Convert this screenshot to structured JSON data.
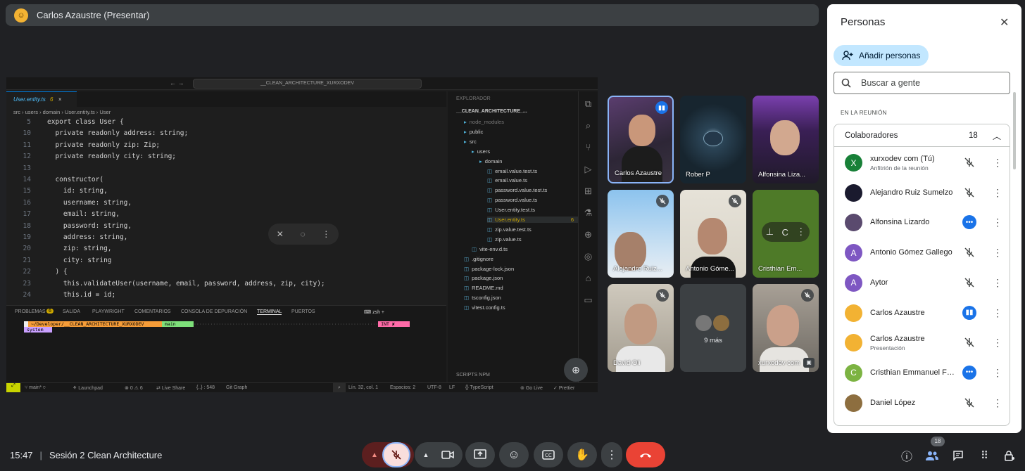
{
  "presenter_bar": {
    "title": "Carlos Azaustre (Presentar)"
  },
  "vscode": {
    "command_center": "__CLEAN_ARCHITECTURE_XURXODEV",
    "tab": {
      "name": "User.entity.ts",
      "problems": "6"
    },
    "breadcrumb": "src › users › domain › User.entity.ts › User",
    "code_lines": [
      {
        "n": "5",
        "text": "export class User {"
      },
      {
        "n": "10",
        "text": "  private readonly address: string;"
      },
      {
        "n": "11",
        "text": "  private readonly zip: Zip;"
      },
      {
        "n": "12",
        "text": "  private readonly city: string;"
      },
      {
        "n": "13",
        "text": ""
      },
      {
        "n": "14",
        "text": "  constructor("
      },
      {
        "n": "15",
        "text": "    id: string,"
      },
      {
        "n": "16",
        "text": "    username: string,"
      },
      {
        "n": "17",
        "text": "    email: string,"
      },
      {
        "n": "18",
        "text": "    password: string,"
      },
      {
        "n": "19",
        "text": "    address: string,"
      },
      {
        "n": "20",
        "text": "    zip: string,"
      },
      {
        "n": "21",
        "text": "    city: string"
      },
      {
        "n": "22",
        "text": "  ) {"
      },
      {
        "n": "23",
        "text": "    this.validateUser(username, email, password, address, zip, city);"
      },
      {
        "n": "24",
        "text": "    this.id = id;"
      }
    ],
    "panel_tabs": [
      "PROBLEMAS",
      "SALIDA",
      "PLAYWRIGHT",
      "COMENTARIOS",
      "CONSOLA DE DEPURACIÓN",
      "TERMINAL",
      "PUERTOS"
    ],
    "problems_count": "6",
    "terminal_shell": "zsh",
    "terminal_path": "~/Developer/__CLEAN_ARCHITECTURE_XURXODEV",
    "terminal_branch": "main",
    "terminal_int": "INT ✘",
    "terminal_system": "system",
    "explorer_title": "EXPLORADOR",
    "explorer_root": "__CLEAN_ARCHITECTURE_...",
    "explorer_items": [
      {
        "label": "node_modules",
        "depth": 1,
        "type": "folder"
      },
      {
        "label": "public",
        "depth": 1,
        "type": "folder"
      },
      {
        "label": "src",
        "depth": 1,
        "type": "folder"
      },
      {
        "label": "users",
        "depth": 2,
        "type": "folder"
      },
      {
        "label": "domain",
        "depth": 3,
        "type": "folder"
      },
      {
        "label": "email.value.test.ts",
        "depth": 4,
        "type": "file"
      },
      {
        "label": "email.value.ts",
        "depth": 4,
        "type": "file"
      },
      {
        "label": "password.value.test.ts",
        "depth": 4,
        "type": "file"
      },
      {
        "label": "password.value.ts",
        "depth": 4,
        "type": "file"
      },
      {
        "label": "User.entity.test.ts",
        "depth": 4,
        "type": "file"
      },
      {
        "label": "User.entity.ts",
        "depth": 4,
        "type": "file",
        "badge": "6"
      },
      {
        "label": "zip.value.test.ts",
        "depth": 4,
        "type": "file"
      },
      {
        "label": "zip.value.ts",
        "depth": 4,
        "type": "file"
      },
      {
        "label": "vite-env.d.ts",
        "depth": 2,
        "type": "file"
      },
      {
        "label": ".gitignore",
        "depth": 1,
        "type": "file"
      },
      {
        "label": "package-lock.json",
        "depth": 1,
        "type": "file"
      },
      {
        "label": "package.json",
        "depth": 1,
        "type": "file"
      },
      {
        "label": "README.md",
        "depth": 1,
        "type": "file"
      },
      {
        "label": "tsconfig.json",
        "depth": 1,
        "type": "file"
      },
      {
        "label": "vitest.config.ts",
        "depth": 1,
        "type": "file"
      }
    ],
    "scripts_npm": "SCRIPTS NPM",
    "status": {
      "branch": "main*",
      "errors": "0",
      "warnings": "6",
      "launchpad": "Launchpad",
      "liveshare": "Live Share",
      "selection": "{..} : 548",
      "gitgraph": "Git Graph",
      "position": "Lín. 32, col. 1",
      "spaces": "Espacios: 2",
      "encoding": "UTF-8",
      "eol": "LF",
      "language": "TypeScript",
      "golive": "Go Live",
      "prettier": "Prettier"
    }
  },
  "tiles": [
    {
      "name": "Carlos Azaustre",
      "speaking": true
    },
    {
      "name": "Rober P"
    },
    {
      "name": "Alfonsina Liza..."
    },
    {
      "name": "Alejandro Ruiz...",
      "muted": true
    },
    {
      "name": "Antonio Góme...",
      "muted": true
    },
    {
      "name": "Cristhian Em...",
      "initial": "C"
    },
    {
      "name": "David Oli",
      "muted": true
    },
    {
      "name": "9 más"
    },
    {
      "name": "xurxodev com",
      "muted": true
    }
  ],
  "people": {
    "title": "Personas",
    "add_label": "Añadir personas",
    "search_placeholder": "Buscar a gente",
    "in_meeting": "EN LA REUNIÓN",
    "group_label": "Colaboradores",
    "group_count": "18",
    "members": [
      {
        "name": "xurxodev com (Tú)",
        "sub": "Anfitrión de la reunión",
        "initial": "X",
        "color": "#188038",
        "state": "muted"
      },
      {
        "name": "Alejandro Ruiz Sumelzo",
        "initial": "",
        "color": "#1a1a2e",
        "state": "muted"
      },
      {
        "name": "Alfonsina Lizardo",
        "initial": "",
        "color": "#5a4a6e",
        "state": "dots"
      },
      {
        "name": "Antonio Gómez Gallego",
        "initial": "A",
        "color": "#7e57c2",
        "state": "muted"
      },
      {
        "name": "Aytor",
        "initial": "A",
        "color": "#7e57c2",
        "state": "muted"
      },
      {
        "name": "Carlos Azaustre",
        "initial": "",
        "color": "#f2b233",
        "state": "speaking"
      },
      {
        "name": "Carlos Azaustre",
        "sub": "Presentación",
        "initial": "",
        "color": "#f2b233",
        "state": "present"
      },
      {
        "name": "Cristhian Emmanuel Fer...",
        "initial": "C",
        "color": "#7cb342",
        "state": "dots"
      },
      {
        "name": "Daniel López",
        "initial": "",
        "color": "#8d6e3f",
        "state": "muted"
      }
    ]
  },
  "bottom": {
    "time": "15:47",
    "meeting": "Sesión 2 Clean Architecture",
    "people_badge": "18"
  },
  "colors": {
    "accent": "#1a73e8",
    "hangup": "#ea4335",
    "add_btn": "#c2e7ff"
  }
}
